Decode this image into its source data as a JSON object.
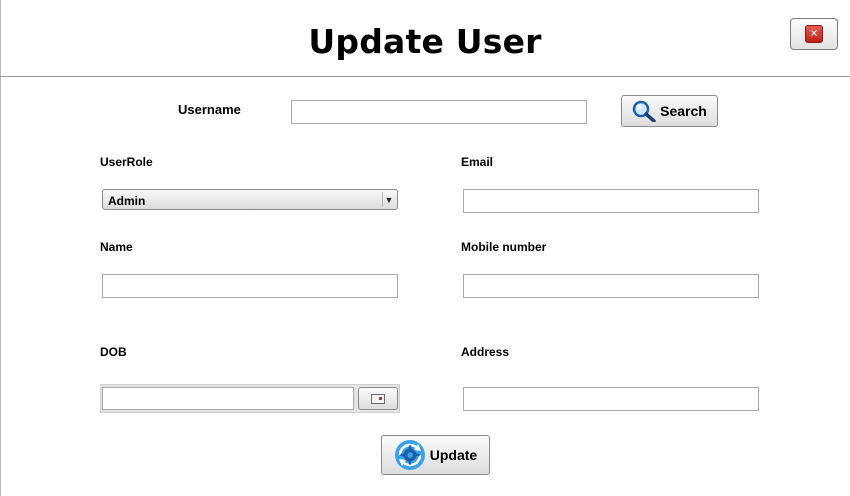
{
  "window": {
    "title": "Update User",
    "close_icon": "close-icon",
    "close_color": "#d0372e"
  },
  "search": {
    "username_label": "Username",
    "username_value": "",
    "button_label": "Search",
    "button_icon": "search-icon"
  },
  "form": {
    "userrole_label": "UserRole",
    "userrole_selected": "Admin",
    "email_label": "Email",
    "email_value": "",
    "name_label": "Name",
    "name_value": "",
    "mobile_label": "Mobile number",
    "mobile_value": "",
    "dob_label": "DOB",
    "dob_value": "",
    "dob_picker_icon": "calendar-icon",
    "address_label": "Address",
    "address_value": ""
  },
  "actions": {
    "update_label": "Update",
    "update_icon": "refresh-gear-icon",
    "update_icon_color": "#2a8fd6"
  }
}
